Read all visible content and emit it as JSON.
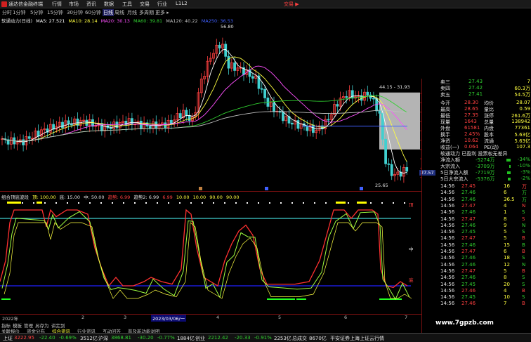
{
  "titlebar": {
    "app_name": "通达信金融终端",
    "menus": [
      "行情",
      "市场",
      "资讯",
      "数据",
      "工具",
      "交易",
      "行业",
      "L1L2"
    ],
    "trade_label": "交易 ▶"
  },
  "period_bar": {
    "items": [
      "分时",
      "1分钟",
      "5分钟",
      "15分钟",
      "30分钟",
      "60分钟",
      "日线",
      "周线",
      "月线",
      "多周期",
      "更多 ▸"
    ],
    "selected": "日线"
  },
  "ma_legend": {
    "stock": "软通动力(日线)",
    "items": [
      {
        "label": "MA5: 27.521",
        "color": "#ffffff"
      },
      {
        "label": "MA10: 28.14",
        "color": "#ffff40"
      },
      {
        "label": "MA20: 30.13",
        "color": "#ff50ff"
      },
      {
        "label": "MA60: 39.81",
        "color": "#30d030"
      },
      {
        "label": "MA120: 40.22",
        "color": "#c0c0c0"
      },
      {
        "label": "MA250: 36.53",
        "color": "#4060ff"
      }
    ]
  },
  "kchart": {
    "high_label": "56.80",
    "low_label": "25.65",
    "mid_label": "44.15 - 31.93",
    "y_ticks": [
      "44.00",
      "42.00",
      "40.00",
      "38.00",
      "36.00",
      "34.00",
      "32.00",
      "30.00",
      "28.00",
      "26.00"
    ],
    "current_price": "27.57"
  },
  "ind_legend": {
    "title": "组合顶底波段",
    "items": [
      {
        "label": "顶: 100.00",
        "color": "#ffff40"
      },
      {
        "label": "底: 15.00",
        "color": "#e0e0e0"
      },
      {
        "label": "中: 50.00",
        "color": "#e0e0e0"
      },
      {
        "label": "趋势: 6.99",
        "color": "#ff4040"
      },
      {
        "label": "趋势2: 6.99",
        "color": "#e0e0e0"
      },
      {
        "label": "6.99",
        "color": "#ff4040"
      },
      {
        "label": "10.00",
        "color": "#ffff40"
      },
      {
        "label": "10.00",
        "color": "#ffff40"
      },
      {
        "label": "90.00",
        "color": "#ffff40"
      },
      {
        "label": "90.00",
        "color": "#ffff40"
      }
    ],
    "y_ticks": [
      "100.00",
      "80.00",
      "60.00",
      "40.00",
      "20.00",
      "0.00"
    ],
    "top_tag": "顶",
    "mid_tag": "中",
    "bot_tag": "底"
  },
  "date_bar": {
    "labels": [
      "2022年",
      "2",
      "3",
      "4",
      "5",
      "6",
      "7"
    ],
    "highlight": "2023/03/06/一"
  },
  "tab_bar": {
    "items": [
      "指标",
      "模板",
      "管理",
      "另存为",
      "讲定到"
    ],
    "items2": [
      "关联报价",
      "资金分布",
      "综合资讯",
      "行业资讯",
      "互动问答",
      "普及新功能说明"
    ],
    "active": "综合资讯"
  },
  "order_book": {
    "rows": [
      {
        "label": "卖三",
        "price": "27.43",
        "vol": "7"
      },
      {
        "label": "卖四",
        "price": "27.42",
        "vol": "60.3万"
      },
      {
        "label": "卖五",
        "price": "27.41",
        "vol": "54.5万"
      }
    ]
  },
  "quote_stats": [
    {
      "k1": "今开",
      "v1": "28.30",
      "k2": "均价",
      "v2": "28.07"
    },
    {
      "k1": "最高",
      "v1": "28.65",
      "k2": "量比",
      "v2": "0.59"
    },
    {
      "k1": "最低",
      "v1": "27.35",
      "k2": "涨停",
      "v2": "261.6万"
    },
    {
      "k1": "现量",
      "v1": "1643",
      "k2": "总量",
      "v2": "138942"
    },
    {
      "k1": "外盘",
      "v1": "61581",
      "k2": "内盘",
      "v2": "77361"
    },
    {
      "k1": "换手",
      "v1": "2.45%",
      "k2": "股本",
      "v2": "5.63亿"
    },
    {
      "k1": "净资",
      "v1": "10.62",
      "k2": "流通",
      "v2": "5.63亿"
    },
    {
      "k1": "收益(一)",
      "v1": "0.064",
      "k2": "PE(动)",
      "v2": "107.3"
    }
  ],
  "flow": {
    "header": "软通动力 已盈利 投票权无差异",
    "rows": [
      {
        "label": "净流入额",
        "value": "-5274万",
        "pct": "-34%",
        "fill": 0.34
      },
      {
        "label": "大宗流入",
        "value": "-3709万",
        "pct": "-10%",
        "fill": 0.1
      },
      {
        "label": "5日净流入额",
        "value": "-7719万",
        "pct": "-3%",
        "fill": 0.3
      },
      {
        "label": "5日大宗流入",
        "value": "-5376万",
        "pct": "-2%",
        "fill": 0.2
      }
    ]
  },
  "ticks": [
    {
      "t": "14:56",
      "p": "27.45",
      "v": "16",
      "f": "万",
      "c": "up"
    },
    {
      "t": "14:56",
      "p": "27.46",
      "v": "6",
      "f": "万",
      "c": "dn"
    },
    {
      "t": "14:56",
      "p": "27.46",
      "v": "36.5",
      "f": "万",
      "c": "dn"
    },
    {
      "t": "14:56",
      "p": "27.47",
      "v": "4",
      "f": "N",
      "c": "up"
    },
    {
      "t": "14:56",
      "p": "27.46",
      "v": "1",
      "f": "S",
      "c": "dn"
    },
    {
      "t": "14:56",
      "p": "27.47",
      "v": "8",
      "f": "S",
      "c": "up"
    },
    {
      "t": "14:56",
      "p": "27.46",
      "v": "9",
      "f": "N",
      "c": "dn"
    },
    {
      "t": "14:56",
      "p": "27.45",
      "v": "5",
      "f": "S",
      "c": "dn"
    },
    {
      "t": "14:56",
      "p": "27.47",
      "v": "5",
      "f": "B",
      "c": "up"
    },
    {
      "t": "14:56",
      "p": "27.46",
      "v": "15",
      "f": "B",
      "c": "dn"
    },
    {
      "t": "14:56",
      "p": "27.47",
      "v": "6",
      "f": "B",
      "c": "up"
    },
    {
      "t": "14:56",
      "p": "27.46",
      "v": "18",
      "f": "S",
      "c": "dn"
    },
    {
      "t": "14:56",
      "p": "27.46",
      "v": "12",
      "f": "N",
      "c": "dn"
    },
    {
      "t": "14:56",
      "p": "27.47",
      "v": "5",
      "f": "B",
      "c": "up"
    },
    {
      "t": "14:56",
      "p": "27.46",
      "v": "8",
      "f": "S",
      "c": "dn"
    },
    {
      "t": "14:56",
      "p": "27.45",
      "v": "20",
      "f": "S",
      "c": "dn"
    },
    {
      "t": "14:56",
      "p": "27.46",
      "v": "4",
      "f": "B",
      "c": "up"
    },
    {
      "t": "14:56",
      "p": "27.45",
      "v": "10",
      "f": "S",
      "c": "dn"
    },
    {
      "t": "14:56",
      "p": "27.46",
      "v": "7",
      "f": "B",
      "c": "up"
    }
  ],
  "status_bar": {
    "items": [
      {
        "text": "上证",
        "cls": "wh"
      },
      {
        "text": "3222.95",
        "cls": "up"
      },
      {
        "text": "-22.40",
        "cls": "dn"
      },
      {
        "text": "-0.69%",
        "cls": "dn"
      },
      {
        "text": "3512亿",
        "cls": "wh"
      },
      {
        "text": "沪深",
        "cls": "wh"
      },
      {
        "text": "3868.81",
        "cls": "dn"
      },
      {
        "text": "-30.20",
        "cls": "dn"
      },
      {
        "text": "-0.77%",
        "cls": "dn"
      },
      {
        "text": "1884亿",
        "cls": "wh"
      },
      {
        "text": "创业",
        "cls": "wh"
      },
      {
        "text": "2212.42",
        "cls": "dn"
      },
      {
        "text": "-20.33",
        "cls": "dn"
      },
      {
        "text": "-0.91%",
        "cls": "dn"
      },
      {
        "text": "2253亿",
        "cls": "wh"
      },
      {
        "text": "总成交",
        "cls": "wh"
      },
      {
        "text": "8670亿",
        "cls": "wh"
      },
      {
        "text": "平安证券上海上证云行情",
        "cls": "wh"
      }
    ]
  },
  "watermark": "www.7gpzb.com"
}
